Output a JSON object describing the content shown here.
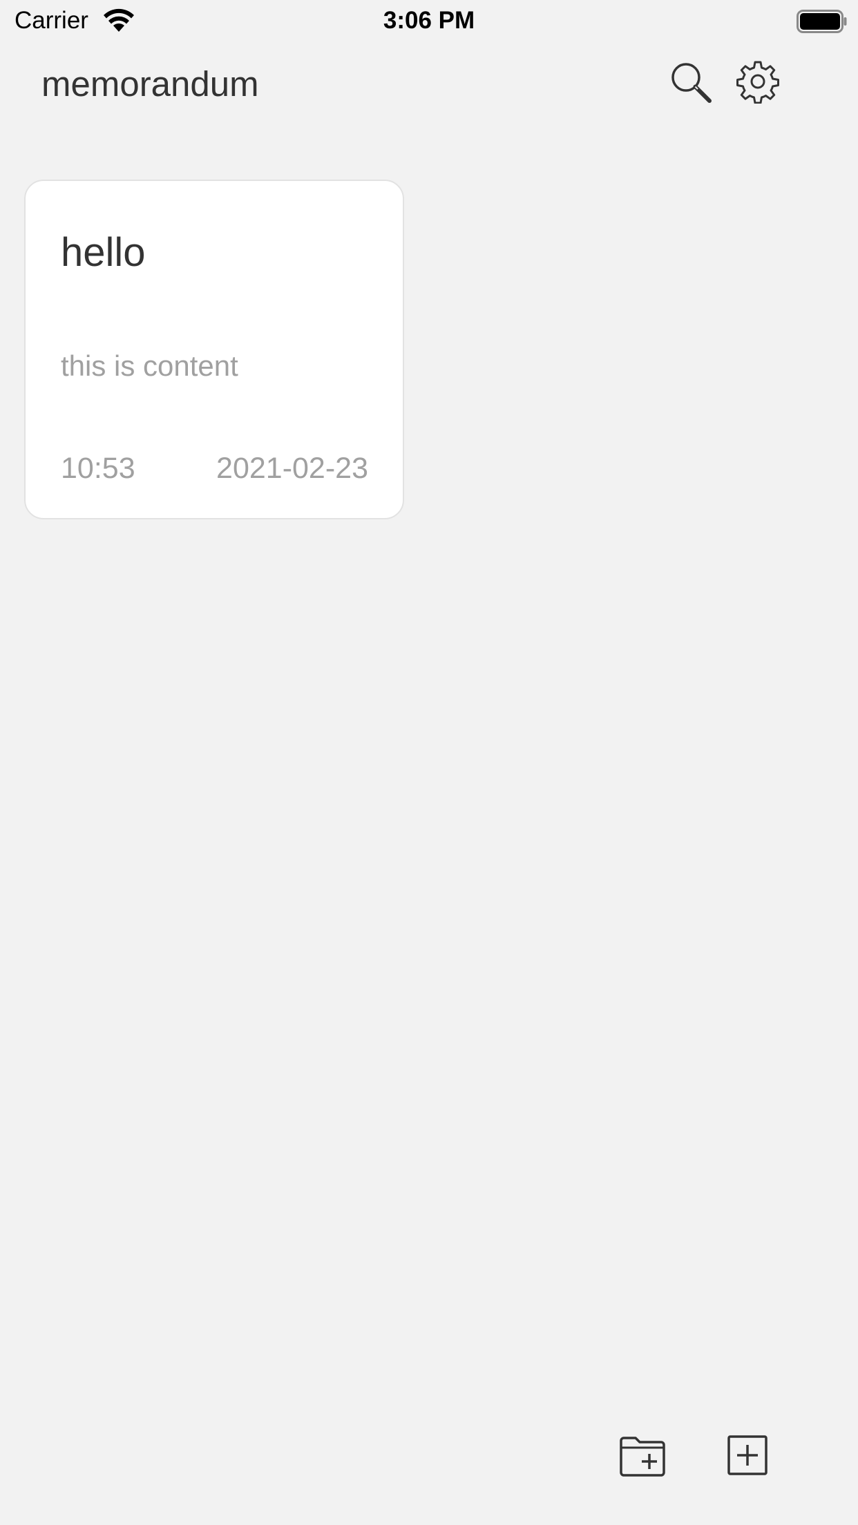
{
  "status_bar": {
    "carrier": "Carrier",
    "time": "3:06 PM",
    "icons": [
      "wifi-icon",
      "battery-icon"
    ]
  },
  "header": {
    "title": "memorandum",
    "icons": [
      "search-icon",
      "gear-icon"
    ]
  },
  "memos": [
    {
      "title": "hello",
      "content": "this is content",
      "time": "10:53",
      "date": "2021-02-23"
    }
  ],
  "toolbar": {
    "icons": [
      "new-folder-icon",
      "new-memo-icon"
    ]
  },
  "colors": {
    "background": "#f2f2f2",
    "card": "#ffffff",
    "primary_text": "#333333",
    "secondary_text": "#a0a0a0"
  }
}
